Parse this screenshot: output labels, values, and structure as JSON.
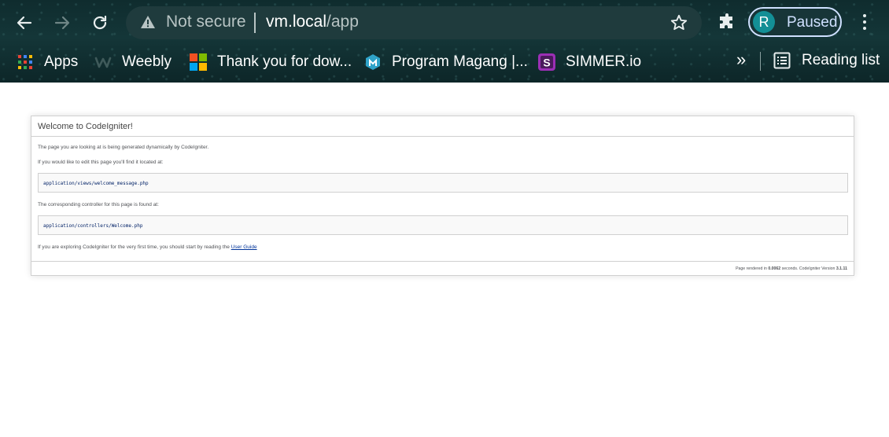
{
  "browser": {
    "omnibox": {
      "security_text": "Not secure",
      "url_host": "vm.local",
      "url_path": "/app"
    },
    "profile": {
      "initial": "R",
      "status": "Paused"
    },
    "bookmarks": [
      {
        "label": "Apps",
        "icon": "apps-grid-icon"
      },
      {
        "label": "Weebly",
        "icon": "weebly-icon"
      },
      {
        "label": "Thank you for dow...",
        "icon": "microsoft-icon"
      },
      {
        "label": "Program Magang |...",
        "icon": "magang-icon"
      },
      {
        "label": "SIMMER.io",
        "icon": "simmer-icon"
      }
    ],
    "overflow_label": "»",
    "reading_list_label": "Reading list"
  },
  "page": {
    "title": "Welcome to CodeIgniter!",
    "intro": "The page you are looking at is being generated dynamically by CodeIgniter.",
    "edit_text": "If you would like to edit this page you'll find it located at:",
    "view_path": "application/views/welcome_message.php",
    "controller_text": "The corresponding controller for this page is found at:",
    "controller_path": "application/controllers/Welcome.php",
    "guide_text": "If you are exploring CodeIgniter for the very first time, you should start by reading the ",
    "guide_link": "User Guide",
    "footer_prefix": "Page rendered in ",
    "render_time": "0.0062",
    "footer_middle": " seconds. CodeIgniter Version ",
    "version": "3.1.11"
  }
}
